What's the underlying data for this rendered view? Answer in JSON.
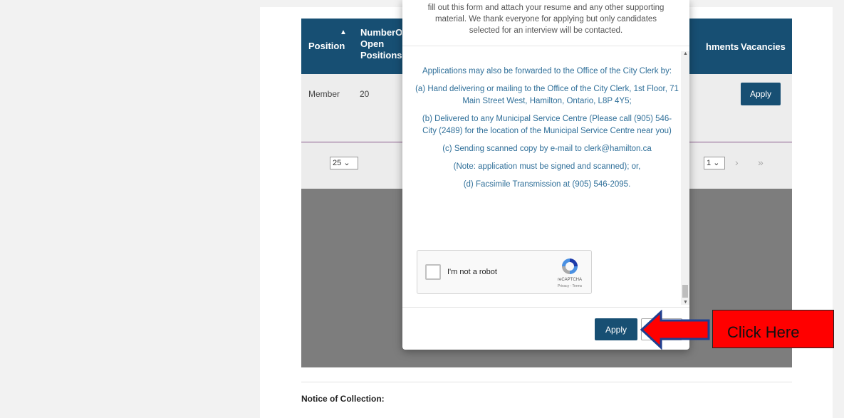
{
  "table": {
    "headers": {
      "position": "Position",
      "sort_icon": "▲",
      "number_open": "NumberOf Open Positions",
      "attachments_partial": "hments",
      "vacancies": "Vacancies"
    },
    "row": {
      "position": "Member",
      "count": "20",
      "apply_label": "Apply"
    },
    "pager": {
      "page_size": "25",
      "page": "1",
      "next": "›",
      "last": "»"
    }
  },
  "notice": "Notice of Collection:",
  "modal": {
    "intro_lines": [
      "fill out this form and attach your resume and any other supporting",
      "material. We thank everyone for applying but only candidates",
      "selected for an interview will be contacted."
    ],
    "body_paragraphs": [
      "Applications may also be forwarded to the Office of the City Clerk by:",
      "(a)      Hand delivering or mailing to the Office of the City Clerk, 1st Floor, 71 Main Street West, Hamilton, Ontario, L8P 4Y5;",
      "(b)      Delivered to any Municipal Service Centre (Please call (905) 546-City (2489) for the location of the Municipal Service Centre near you)",
      "(c)      Sending scanned copy by e-mail to clerk@hamilton.ca",
      "(Note: application must be signed and scanned); or,",
      "(d)      Facsimile Transmission at (905) 546-2095."
    ],
    "captcha": {
      "label": "I'm not a robot",
      "brand": "reCAPTCHA",
      "links": "Privacy - Terms"
    },
    "apply_label": "Apply"
  },
  "annotation": {
    "callout_text": "Click Here"
  },
  "colors": {
    "header_blue": "#174f73",
    "link_blue": "#2f6f99",
    "callout_red": "#ff0000"
  }
}
